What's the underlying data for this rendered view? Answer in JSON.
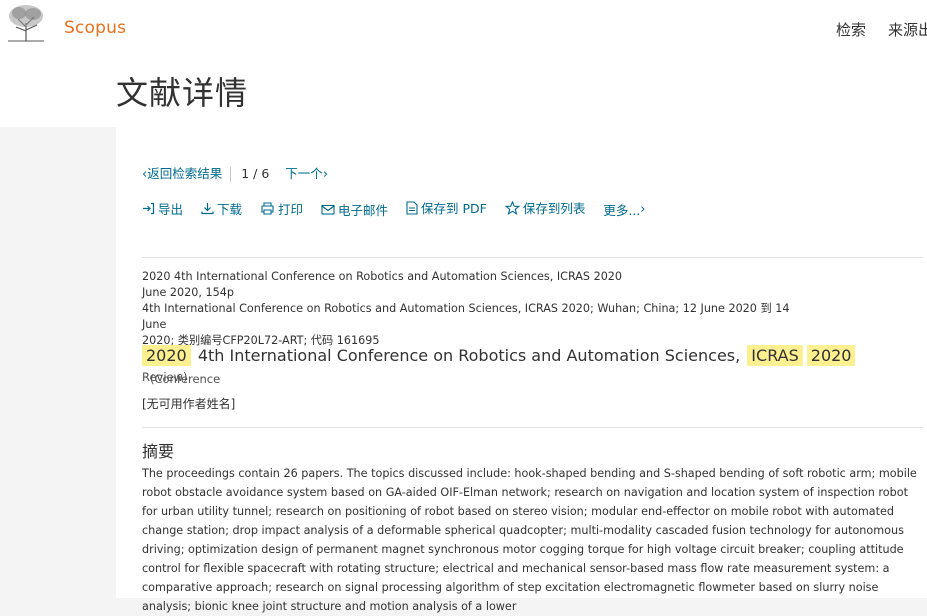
{
  "header": {
    "logo_text": "Scopus",
    "nav": {
      "search": "检索",
      "sources": "来源出版物"
    }
  },
  "page_title": "文献详情",
  "result_nav": {
    "back": "返回检索结果",
    "position": "1 / 6",
    "next": "下一个"
  },
  "toolbar": {
    "export": "导出",
    "download": "下载",
    "print": "打印",
    "email": "电子邮件",
    "save_pdf": "保存到 PDF",
    "save_list": "保存到列表",
    "more": "更多..."
  },
  "source": {
    "line1": "2020 4th International Conference on Robotics and Automation Sciences, ICRAS 2020",
    "line2": "June 2020, 154p",
    "line3": "4th International Conference on Robotics and Automation Sciences, ICRAS 2020; Wuhan; China; 12 June 2020 到 14 June",
    "line4": "2020; 类别编号CFP20L72-ART; 代码 161695"
  },
  "document": {
    "title_p1": "2020",
    "title_p2": "4th International Conference on Robotics and Automation Sciences,",
    "title_p3": "ICRAS",
    "title_p4": "2020",
    "type_p1": "(Conference",
    "type_p2": "Review)",
    "authors": "[无可用作者姓名]"
  },
  "abstract": {
    "heading": "摘要",
    "text": "The proceedings contain 26 papers. The topics discussed include: hook-shaped bending and S-shaped bending of soft robotic arm; mobile robot obstacle avoidance system based on GA-aided OIF-Elman network; research on navigation and location system of inspection robot for urban utility tunnel; research on positioning of robot based on stereo vision; modular end-effector on mobile robot with automated change station; drop impact analysis of a deformable spherical quadcopter; multi-modality cascaded fusion technology for autonomous driving; optimization design of permanent magnet synchronous motor cogging torque for high voltage circuit breaker; coupling attitude control for flexible spacecraft with rotating structure; electrical and mechanical sensor-based mass flow rate measurement system: a comparative approach; research on signal processing algorithm of step excitation electromagnetic flowmeter based on slurry noise analysis; bionic knee joint structure and motion analysis of a lower"
  },
  "colors": {
    "brand": "#e9711c",
    "link": "#006a8e",
    "highlight": "#fdf090"
  }
}
